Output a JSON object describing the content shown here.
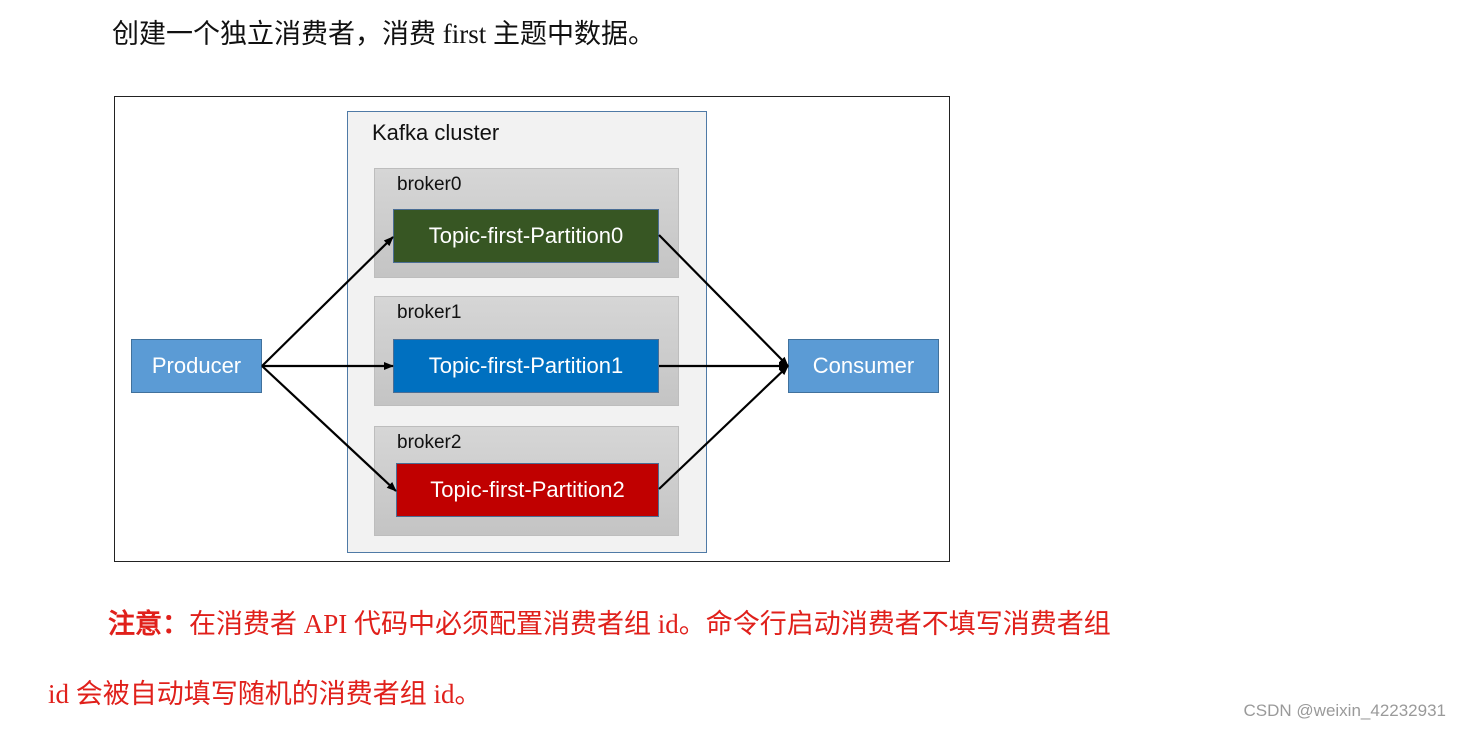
{
  "heading": "创建一个独立消费者，消费 first 主题中数据。",
  "diagram": {
    "cluster_title": "Kafka cluster",
    "producer": "Producer",
    "consumer": "Consumer",
    "brokers": [
      {
        "label": "broker0",
        "partition": "Topic-first-Partition0",
        "color": "#375623"
      },
      {
        "label": "broker1",
        "partition": "Topic-first-Partition1",
        "color": "#0070c0"
      },
      {
        "label": "broker2",
        "partition": "Topic-first-Partition2",
        "color": "#c00000"
      }
    ],
    "node_color": "#5b9bd5"
  },
  "note": {
    "label": "注意：",
    "line1": "在消费者 API 代码中必须配置消费者组 id。命令行启动消费者不填写消费者组",
    "line2": "id 会被自动填写随机的消费者组 id。"
  },
  "watermark": "CSDN @weixin_42232931"
}
